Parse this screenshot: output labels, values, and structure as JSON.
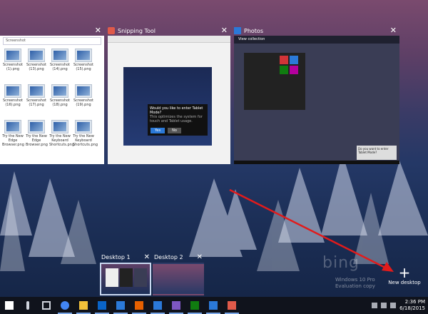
{
  "colors": {
    "accent": "#2b79d8",
    "arrow": "#e21b1b",
    "taskbar": "#10131c"
  },
  "windows": {
    "explorer": {
      "close_glyph": "✕",
      "address": "Screenshot",
      "items": [
        {
          "label": "Screenshot (1).png"
        },
        {
          "label": "Screenshot (13).png"
        },
        {
          "label": "Screenshot (14).png"
        },
        {
          "label": "Screenshot (15).png"
        },
        {
          "label": "Screenshot (16).png"
        },
        {
          "label": "Screenshot (17).png"
        },
        {
          "label": "Screenshot (18).png"
        },
        {
          "label": "Screenshot (19).png"
        },
        {
          "label": "Try the New Edge Browser.png"
        },
        {
          "label": "Try the New Edge Browser.png"
        },
        {
          "label": "Try the New Keyboard Shortcuts.png"
        },
        {
          "label": "Try the New Keyboard Shortcuts.png"
        }
      ]
    },
    "snip": {
      "title": "Snipping Tool",
      "close_glyph": "✕",
      "dialog_title": "Would you like to enter Tablet Mode?",
      "dialog_text": "This optimizes the system for touch and Tablet usage.",
      "yes": "Yes",
      "no": "No"
    },
    "photos": {
      "title": "Photos",
      "close_glyph": "✕",
      "collection": "View collection",
      "dialog_text": "Do you want to enter Tablet Mode?"
    }
  },
  "desktops": {
    "desk1": {
      "label": "Desktop 1",
      "close_glyph": "✕"
    },
    "desk2": {
      "label": "Desktop 2",
      "close_glyph": "✕"
    },
    "new": {
      "plus": "+",
      "label": "New desktop"
    }
  },
  "watermark": {
    "text": "bing",
    "line1": "Windows 10 Pro",
    "line2": "Evaluation copy"
  },
  "taskbar": {
    "icons": [
      "windows-logo",
      "microphone",
      "task-view",
      "chrome",
      "file-explorer",
      "outlook",
      "edge",
      "firefox",
      "mail",
      "visual-studio",
      "xbox",
      "photos",
      "snipping-tool"
    ],
    "time": "2:36 PM",
    "date": "6/18/2015"
  }
}
